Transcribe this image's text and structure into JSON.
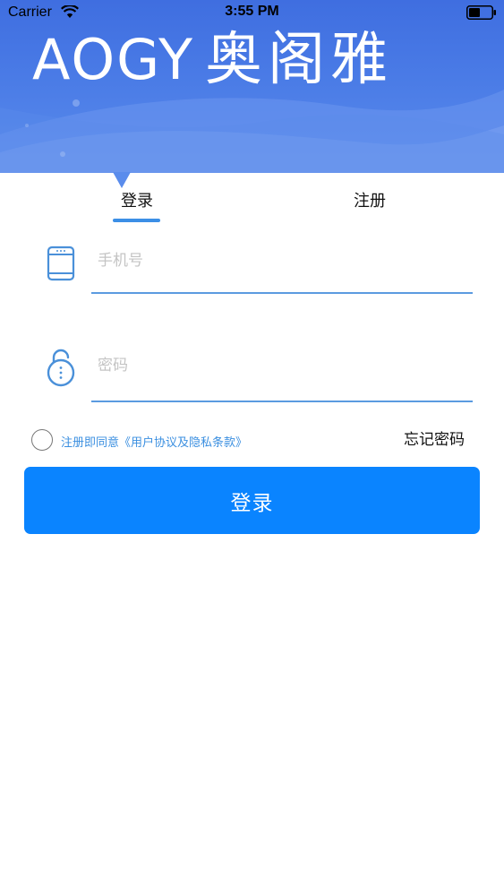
{
  "status_bar": {
    "carrier": "Carrier",
    "time": "3:55 PM"
  },
  "header": {
    "logo_latin": "AOGY",
    "logo_chinese": "奥阁雅"
  },
  "tabs": [
    {
      "label": "登录",
      "active": true
    },
    {
      "label": "注册",
      "active": false
    }
  ],
  "form": {
    "phone": {
      "placeholder": "手机号",
      "value": "",
      "icon": "phone-icon"
    },
    "password": {
      "placeholder": "密码",
      "value": "",
      "icon": "lock-icon"
    }
  },
  "agreement": {
    "prefix": "注册即同意",
    "link": "《用户协议及隐私条款》",
    "checked": false
  },
  "forgot_password": "忘记密码",
  "submit_label": "登录",
  "colors": {
    "banner": "#4a7be6",
    "accent": "#3c8fe6",
    "button": "#0a84ff",
    "link": "#3b8fe0"
  }
}
